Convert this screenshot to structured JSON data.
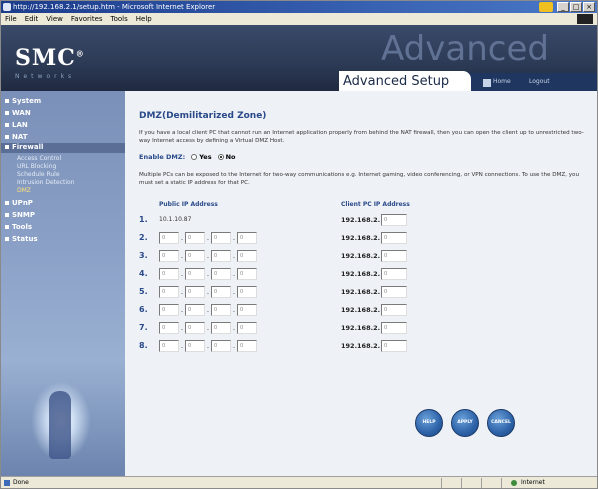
{
  "window": {
    "title": "http://192.168.2.1/setup.htm - Microsoft Internet Explorer",
    "controls": [
      "_",
      "□",
      "×"
    ]
  },
  "menu": [
    "File",
    "Edit",
    "View",
    "Favorites",
    "Tools",
    "Help"
  ],
  "header": {
    "logo": "SMC",
    "logo_mark": "®",
    "tagline": "Networks",
    "big_word": "Advanced",
    "section_title": "Advanced Setup",
    "home_link": "Home",
    "logout_link": "Logout"
  },
  "sidebar": {
    "items": [
      {
        "label": "System"
      },
      {
        "label": "WAN"
      },
      {
        "label": "LAN"
      },
      {
        "label": "NAT"
      },
      {
        "label": "Firewall"
      }
    ],
    "sub_items": [
      {
        "label": "Access Control"
      },
      {
        "label": "URL Blocking"
      },
      {
        "label": "Schedule Rule"
      },
      {
        "label": "Intrusion Detection"
      },
      {
        "label": "DMZ"
      }
    ],
    "items_after": [
      {
        "label": "UPnP"
      },
      {
        "label": "SNMP"
      },
      {
        "label": "Tools"
      },
      {
        "label": "Status"
      }
    ]
  },
  "main": {
    "title": "DMZ(Demilitarized Zone)",
    "description": "If you have a local client PC that cannot run an Internet application properly from behind the NAT firewall, then you can open the client up to unrestricted two-way Internet access by defining a Virtual DMZ Host.",
    "enable_label": "Enable DMZ:",
    "yes_label": "Yes",
    "no_label": "No",
    "selected": "No",
    "description2": "Multiple PCs can be exposed to the Internet for two-way communications e.g. Internet gaming, video conferencing, or VPN connections. To use the DMZ, you must set a static IP address for that PC.",
    "public_header": "Public IP Address",
    "client_header": "Client PC IP Address",
    "client_prefix": "192.168.2.",
    "rows": [
      {
        "num": "1.",
        "static": "10.1.10.87",
        "octets": [],
        "client": "0"
      },
      {
        "num": "2.",
        "static": "",
        "octets": [
          "0",
          "0",
          "0",
          "0"
        ],
        "client": "0"
      },
      {
        "num": "3.",
        "static": "",
        "octets": [
          "0",
          "0",
          "0",
          "0"
        ],
        "client": "0"
      },
      {
        "num": "4.",
        "static": "",
        "octets": [
          "0",
          "0",
          "0",
          "0"
        ],
        "client": "0"
      },
      {
        "num": "5.",
        "static": "",
        "octets": [
          "0",
          "0",
          "0",
          "0"
        ],
        "client": "0"
      },
      {
        "num": "6.",
        "static": "",
        "octets": [
          "0",
          "0",
          "0",
          "0"
        ],
        "client": "0"
      },
      {
        "num": "7.",
        "static": "",
        "octets": [
          "0",
          "0",
          "0",
          "0"
        ],
        "client": "0"
      },
      {
        "num": "8.",
        "static": "",
        "octets": [
          "0",
          "0",
          "0",
          "0"
        ],
        "client": "0"
      }
    ],
    "buttons": [
      {
        "name": "help-button",
        "label": "HELP"
      },
      {
        "name": "apply-button",
        "label": "APPLY"
      },
      {
        "name": "cancel-button",
        "label": "CANCEL"
      }
    ]
  },
  "status": {
    "left": "Done",
    "zone": "Internet"
  },
  "colors": {
    "accent": "#2a4a8a",
    "sidebar": "#8aa0c6",
    "header": "#2c3a55"
  }
}
